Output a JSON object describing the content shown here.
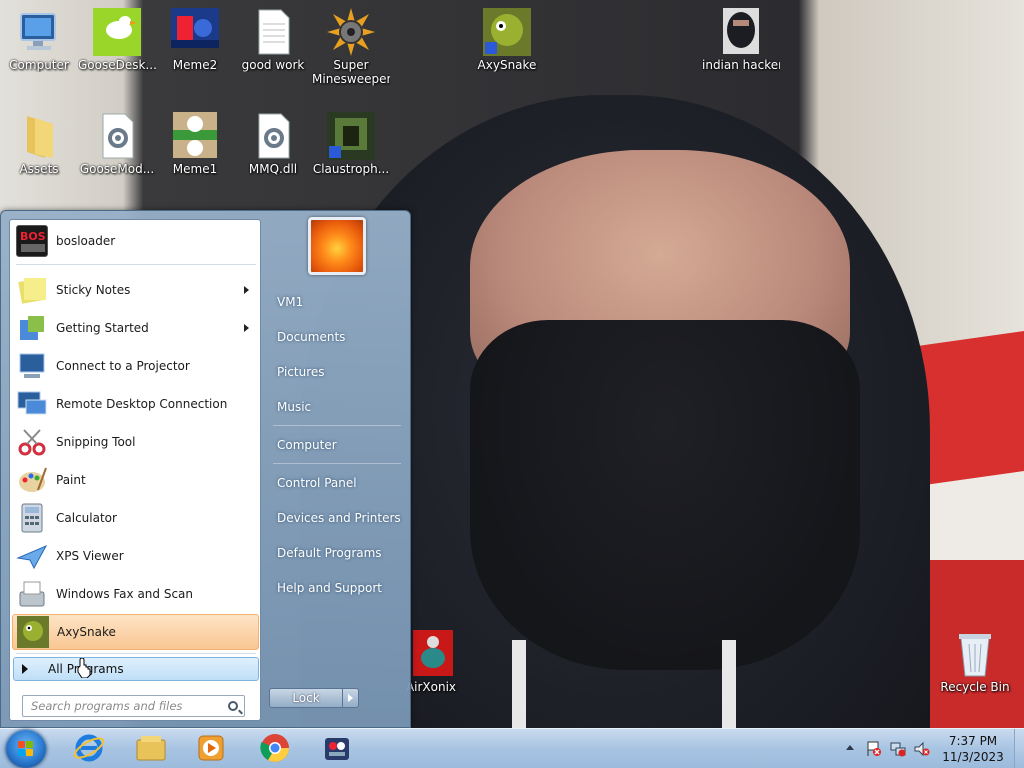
{
  "desktop": {
    "icons": [
      {
        "label": "Computer"
      },
      {
        "label": "GooseDesk..."
      },
      {
        "label": "Meme2"
      },
      {
        "label": "good work"
      },
      {
        "label": "Super Minesweeper"
      },
      {
        "label": "AxySnake"
      },
      {
        "label": "indian hacker"
      },
      {
        "label": "Assets"
      },
      {
        "label": "GooseMod..."
      },
      {
        "label": "Meme1"
      },
      {
        "label": "MMQ.dll"
      },
      {
        "label": "Claustroph..."
      },
      {
        "label": "AirXonix"
      },
      {
        "label": "Recycle Bin"
      }
    ]
  },
  "start_menu": {
    "pinned": [
      {
        "label": "bosloader"
      }
    ],
    "programs": [
      {
        "label": "Sticky Notes",
        "has_submenu": true
      },
      {
        "label": "Getting Started",
        "has_submenu": true
      },
      {
        "label": "Connect to a Projector",
        "has_submenu": false
      },
      {
        "label": "Remote Desktop Connection",
        "has_submenu": false
      },
      {
        "label": "Snipping Tool",
        "has_submenu": false
      },
      {
        "label": "Paint",
        "has_submenu": false
      },
      {
        "label": "Calculator",
        "has_submenu": false
      },
      {
        "label": "XPS Viewer",
        "has_submenu": false
      },
      {
        "label": "Windows Fax and Scan",
        "has_submenu": false
      },
      {
        "label": "AxySnake",
        "has_submenu": false,
        "highlighted": true
      }
    ],
    "all_programs_label": "All Programs",
    "search_placeholder": "Search programs and files",
    "right_items": [
      {
        "label": "VM1"
      },
      {
        "label": "Documents"
      },
      {
        "label": "Pictures"
      },
      {
        "label": "Music"
      },
      {
        "label": "Computer"
      },
      {
        "label": "Control Panel"
      },
      {
        "label": "Devices and Printers"
      },
      {
        "label": "Default Programs"
      },
      {
        "label": "Help and Support"
      }
    ],
    "lock_label": "Lock"
  },
  "taskbar": {
    "pinned": [
      {
        "icon": "internet-explorer-icon"
      },
      {
        "icon": "file-explorer-icon"
      },
      {
        "icon": "media-player-icon"
      },
      {
        "icon": "chrome-icon"
      },
      {
        "icon": "app-icon"
      }
    ],
    "clock": {
      "time": "7:37 PM",
      "date": "11/3/2023"
    }
  }
}
